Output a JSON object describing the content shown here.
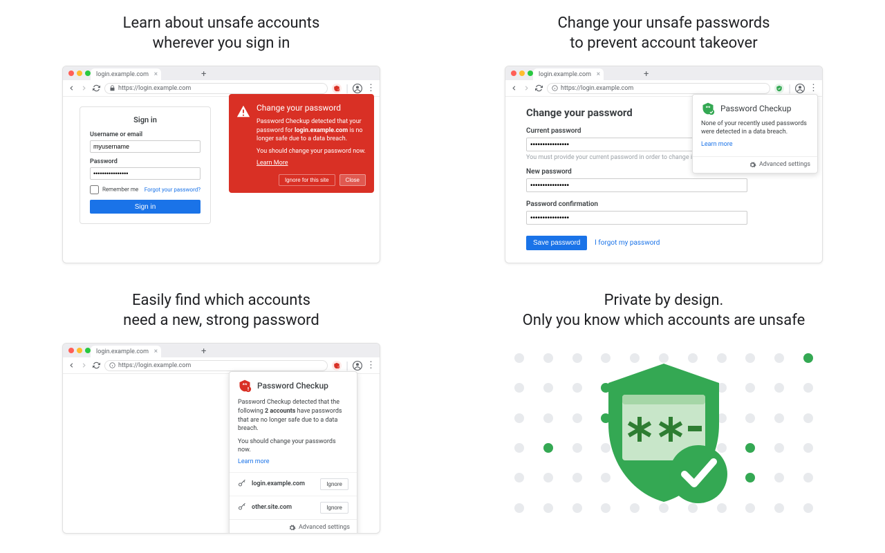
{
  "captions": {
    "c1a": "Learn about unsafe accounts",
    "c1b": "wherever you sign in",
    "c2a": "Change your unsafe passwords",
    "c2b": "to prevent account takeover",
    "c3a": "Easily find which accounts",
    "c3b": "need a new, strong password",
    "c4a": "Private by design.",
    "c4b": "Only you know which accounts are unsafe"
  },
  "browser": {
    "tab_title": "login.example.com",
    "url": "https://login.example.com"
  },
  "card1": {
    "signin_title": "Sign in",
    "username_label": "Username or email",
    "username_value": "myusername",
    "password_label": "Password",
    "password_value": "••••••••••••••••",
    "remember": "Remember me",
    "forgot": "Forgot your password?",
    "signin_btn": "Sign in",
    "alert_title": "Change your password",
    "alert_body1": "Password Checkup detected that your password for ",
    "alert_site": "login.example.com",
    "alert_body2": " is no longer safe due to a data breach.",
    "alert_body3": "You should change your password now.",
    "alert_learn": "Learn More",
    "alert_ignore": "Ignore for this site",
    "alert_close": "Close"
  },
  "card2": {
    "heading": "Change your password",
    "current_label": "Current password",
    "current_value": "••••••••••••••••",
    "hint": "You must provide your current password in order to change it.",
    "new_label": "New password",
    "new_value": "••••••••••••••••",
    "confirm_label": "Password confirmation",
    "confirm_value": "••••••••••••••••",
    "save_btn": "Save password",
    "forgot_link": "I forgot my password",
    "popup_title": "Password Checkup",
    "popup_body": "None of your recently used passwords were detected in a data breach.",
    "popup_learn": "Learn more",
    "popup_advanced": "Advanced settings"
  },
  "card3": {
    "popup_title": "Password Checkup",
    "body1": "Password Checkup detected that the following ",
    "body_count": "2 accounts",
    "body2": " have passwords that are no longer safe due to a data breach.",
    "body3": "You should change your passwords now.",
    "learn": "Learn more",
    "acct1": "login.example.com",
    "acct2": "other.site.com",
    "ignore": "Ignore",
    "advanced": "Advanced settings"
  }
}
